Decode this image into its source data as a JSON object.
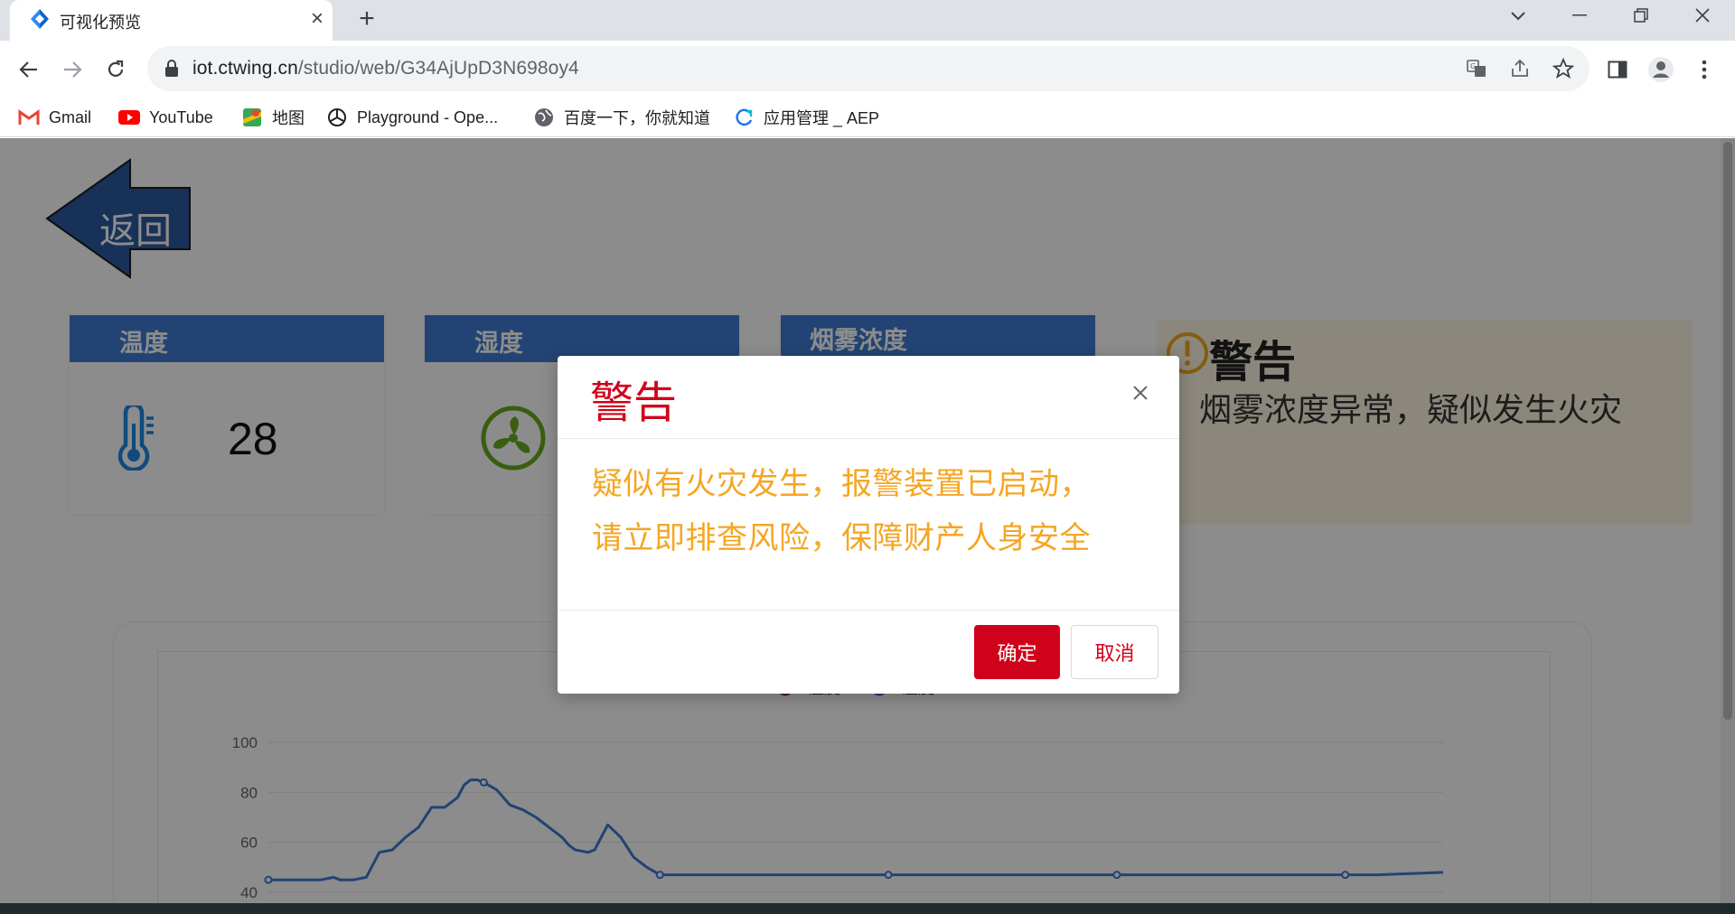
{
  "browser": {
    "tab_title": "可视化预览",
    "tab_close": "×",
    "new_tab": "+",
    "url_host": "iot.ctwing.cn",
    "url_path": "/studio/web/G34AjUpD3N698oy4",
    "bookmarks": [
      {
        "label": "Gmail",
        "icon": "gmail-icon"
      },
      {
        "label": "YouTube",
        "icon": "youtube-icon"
      },
      {
        "label": "地图",
        "icon": "maps-icon"
      },
      {
        "label": "Playground - Ope...",
        "icon": "openai-icon"
      },
      {
        "label": "百度一下，你就知道",
        "icon": "globe-icon"
      },
      {
        "label": "应用管理 _ AEP",
        "icon": "aep-icon"
      }
    ]
  },
  "page": {
    "back_label": "返回",
    "cards": [
      {
        "title": "温度",
        "value": "28",
        "icon": "thermometer-icon"
      },
      {
        "title": "湿度",
        "value": "",
        "icon": "fan-icon"
      },
      {
        "title": "烟雾浓度",
        "value": "",
        "icon": ""
      }
    ],
    "warning": {
      "title": "警告",
      "message": "烟雾浓度异常，疑似发生火灾"
    }
  },
  "chart_data": {
    "type": "line",
    "title": "",
    "legend": [
      {
        "name": "温度",
        "color": "#8b4513"
      },
      {
        "name": "湿度",
        "color": "#3e7bd1"
      }
    ],
    "legend_placement": "top-center",
    "ylim": [
      40,
      100
    ],
    "yticks": [
      40,
      60,
      80,
      100
    ],
    "grid": true,
    "series": [
      {
        "name": "湿度",
        "color": "#3e7bd1",
        "x": [
          0,
          4,
          8,
          10,
          11,
          13,
          15,
          17,
          19,
          21,
          23,
          25,
          27,
          29,
          30,
          31,
          32,
          33,
          35,
          37,
          39,
          41,
          43,
          45,
          46,
          47,
          49,
          50,
          51,
          52,
          54,
          56,
          58,
          60,
          70,
          80,
          90,
          100,
          110,
          120,
          130,
          140,
          150,
          160,
          170,
          180
        ],
        "values": [
          45,
          45,
          45,
          46,
          45,
          45,
          46,
          56,
          57,
          62,
          66,
          74,
          74,
          78,
          83,
          85,
          85,
          84,
          81,
          75,
          73,
          70,
          66,
          62,
          59,
          57,
          56,
          57,
          62,
          67,
          62,
          54,
          50,
          47,
          47,
          47,
          47,
          47,
          47,
          47,
          47,
          47,
          47,
          47,
          47,
          48
        ],
        "markers": [
          0,
          33,
          60,
          95,
          130,
          165
        ]
      }
    ]
  },
  "modal": {
    "title": "警告",
    "body_line1": "疑似有火灾发生，报警装置已启动，",
    "body_line2": "请立即排查风险，保障财产人身安全",
    "ok_label": "确定",
    "cancel_label": "取消"
  },
  "colors": {
    "primary": "#d0021b",
    "warning_text": "#f5a623",
    "card_header": "#3e7bd1"
  }
}
